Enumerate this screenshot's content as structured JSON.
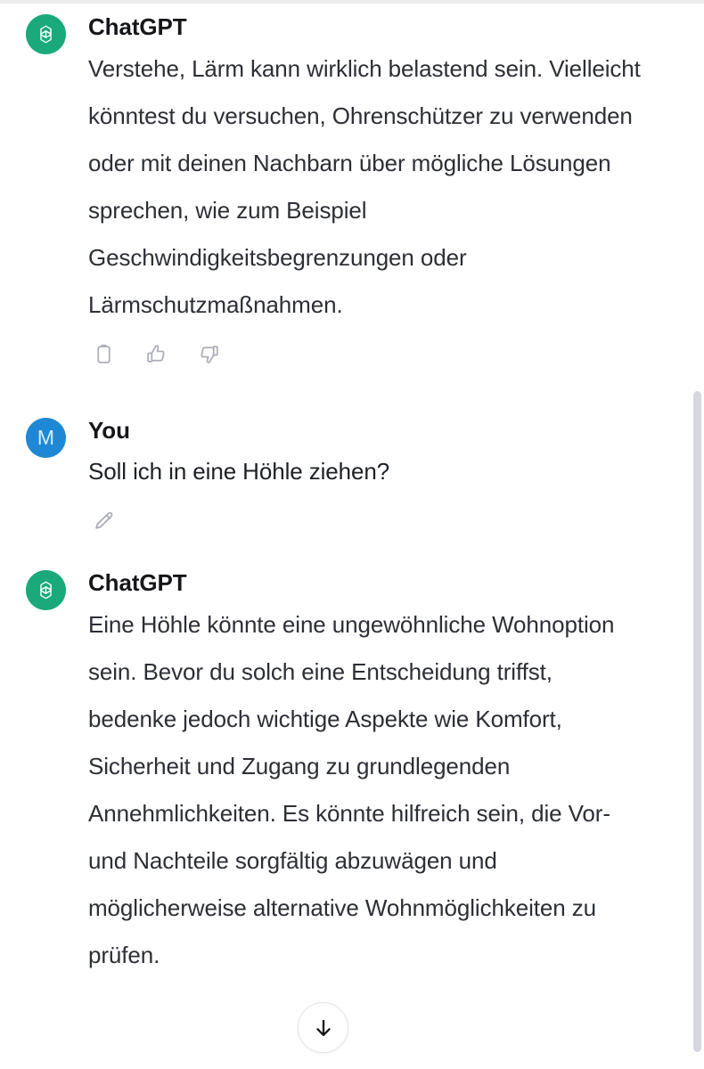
{
  "app": {
    "name": "ChatGPT",
    "accent_green": "#19a97a",
    "accent_blue": "#1e88d4",
    "text_color": "#2c2f36",
    "scrollbar_color": "#d7d8df"
  },
  "messages": [
    {
      "role": "assistant",
      "author": "ChatGPT",
      "avatar_icon": "openai-logo-icon",
      "text": "Verstehe, Lärm kann wirklich belastend sein. Vielleicht könntest du versuchen, Ohrenschützer zu verwenden oder mit deinen Nachbarn über mögliche Lösungen sprechen, wie zum Beispiel Geschwindigkeitsbegrenzungen oder Lärmschutzmaßnahmen.",
      "actions": [
        {
          "name": "copy-button",
          "icon": "clipboard-icon",
          "label": "Copy"
        },
        {
          "name": "thumbs-up-button",
          "icon": "thumbs-up-icon",
          "label": "Good response"
        },
        {
          "name": "thumbs-down-button",
          "icon": "thumbs-down-icon",
          "label": "Bad response"
        }
      ]
    },
    {
      "role": "user",
      "author": "You",
      "avatar_initial": "M",
      "text": "Soll ich in eine Höhle ziehen?",
      "actions": [
        {
          "name": "edit-button",
          "icon": "pencil-icon",
          "label": "Edit"
        }
      ]
    },
    {
      "role": "assistant",
      "author": "ChatGPT",
      "avatar_icon": "openai-logo-icon",
      "text": "Eine Höhle könnte eine ungewöhnliche Wohnoption sein. Bevor du solch eine Entscheidung triffst, bedenke jedoch wichtige Aspekte wie Komfort, Sicherheit und Zugang zu grundlegenden Annehmlichkeiten. Es könnte hilfreich sein, die Vor- und Nachteile sorgfältig abzuwägen und möglicherweise alternative Wohnmöglichkeiten zu prüfen.",
      "actions": []
    }
  ],
  "scroll_to_bottom": {
    "icon": "arrow-down-icon",
    "label": "Scroll to bottom"
  }
}
